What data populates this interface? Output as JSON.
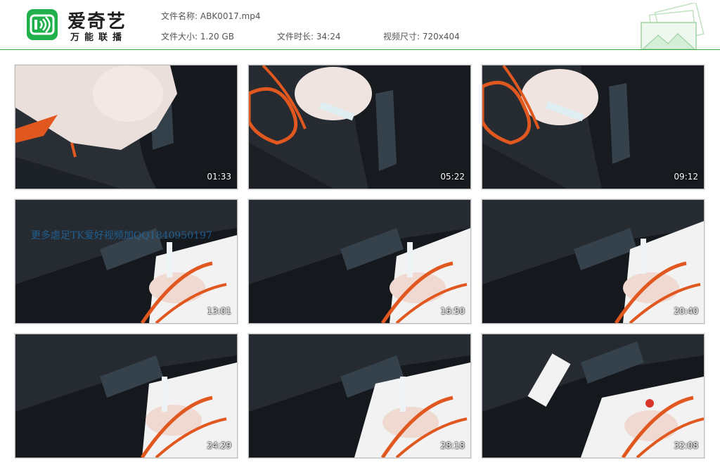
{
  "app": {
    "name": "爱奇艺",
    "tagline": "万能联播",
    "logo_icon": "iqiyi-tv-icon",
    "brand_color": "#21b04b",
    "accent_line_color": "#3aa83a"
  },
  "file_info": {
    "name_label": "文件名称:",
    "name_value": "ABK0017.mp4",
    "size_label": "文件大小:",
    "size_value": "1.20 GB",
    "duration_label": "文件时长:",
    "duration_value": "34:24",
    "dimensions_label": "视频尺寸:",
    "dimensions_value": "720x404"
  },
  "thumbnails": [
    {
      "timestamp": "01:33",
      "watermark": ""
    },
    {
      "timestamp": "05:22",
      "watermark": ""
    },
    {
      "timestamp": "09:12",
      "watermark": ""
    },
    {
      "timestamp": "13:01",
      "watermark": "更多虐足TK爱好视频加QQ1840950197"
    },
    {
      "timestamp": "16:50",
      "watermark": ""
    },
    {
      "timestamp": "20:40",
      "watermark": ""
    },
    {
      "timestamp": "24:29",
      "watermark": ""
    },
    {
      "timestamp": "28:18",
      "watermark": ""
    },
    {
      "timestamp": "32:08",
      "watermark": ""
    }
  ]
}
